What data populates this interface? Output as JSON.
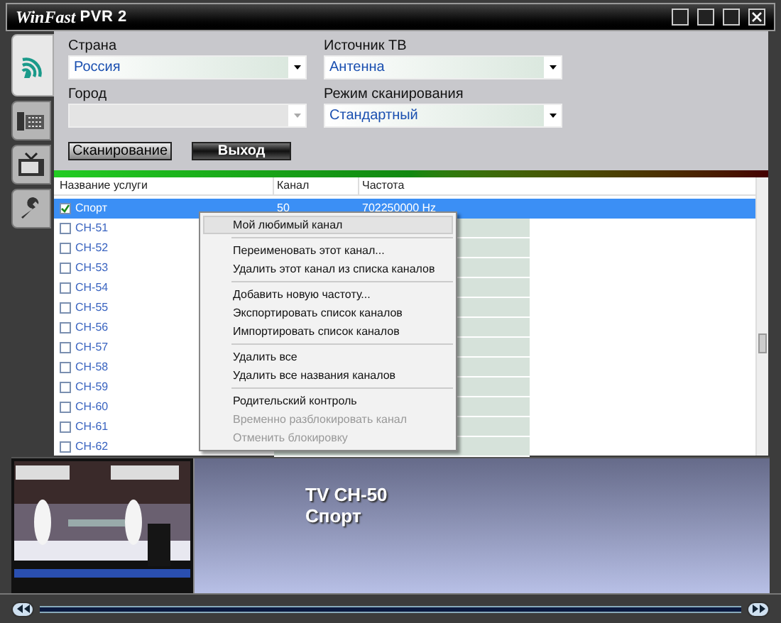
{
  "window": {
    "title": "WinFast",
    "title_badge": "PVR 2"
  },
  "side_tabs": [
    {
      "selected": true
    },
    {
      "selected": false
    },
    {
      "selected": false
    },
    {
      "selected": false
    }
  ],
  "form": {
    "fields": [
      {
        "label": "Страна",
        "value": "Россия",
        "disabled": false
      },
      {
        "label": "Источник ТВ",
        "value": "Антенна",
        "disabled": false
      },
      {
        "label": "Город",
        "disabled": true
      },
      {
        "label": "Режим сканирования",
        "value": "Стандартный",
        "disabled": false
      }
    ],
    "buttons": [
      "Сканирование",
      "Выход"
    ]
  },
  "table": {
    "columns": [
      "Название услуги",
      "Канал",
      "Частота"
    ],
    "rows": [
      {
        "name": "Спорт",
        "checked": true,
        "selected": true,
        "channel": "50",
        "frequency": "702250000 Hz"
      },
      {
        "name": "CH-51",
        "checked": false,
        "selected": false
      },
      {
        "name": "CH-52",
        "checked": false,
        "selected": false
      },
      {
        "name": "CH-53",
        "checked": false,
        "selected": false
      },
      {
        "name": "CH-54",
        "checked": false,
        "selected": false
      },
      {
        "name": "CH-55",
        "checked": false,
        "selected": false
      },
      {
        "name": "CH-56",
        "checked": false,
        "selected": false
      },
      {
        "name": "CH-57",
        "checked": false,
        "selected": false
      },
      {
        "name": "CH-58",
        "checked": false,
        "selected": false
      },
      {
        "name": "CH-59",
        "checked": false,
        "selected": false
      },
      {
        "name": "CH-60",
        "checked": false,
        "selected": false
      },
      {
        "name": "CH-61",
        "checked": false,
        "selected": false
      },
      {
        "name": "CH-62",
        "checked": false,
        "selected": false
      }
    ]
  },
  "context_menu": {
    "groups": [
      {
        "items": [
          {
            "label": "Мой любимый канал",
            "selected": true,
            "disabled": false
          }
        ]
      },
      {
        "items": [
          {
            "label": "Переименовать этот канал...",
            "selected": false,
            "disabled": false
          },
          {
            "label": "Удалить этот канал из списка каналов",
            "selected": false,
            "disabled": false
          }
        ]
      },
      {
        "items": [
          {
            "label": "Добавить новую частоту...",
            "selected": false,
            "disabled": false
          },
          {
            "label": "Экспортировать список каналов",
            "selected": false,
            "disabled": false
          },
          {
            "label": "Импортировать список каналов",
            "selected": false,
            "disabled": false
          }
        ]
      },
      {
        "items": [
          {
            "label": "Удалить все",
            "selected": false,
            "disabled": false
          },
          {
            "label": "Удалить все названия каналов",
            "selected": false,
            "disabled": false
          }
        ]
      },
      {
        "items": [
          {
            "label": "Родительский контроль",
            "selected": false,
            "disabled": false
          },
          {
            "label": "Временно разблокировать канал",
            "selected": false,
            "disabled": true
          },
          {
            "label": "Отменить блокировку",
            "selected": false,
            "disabled": true
          }
        ]
      }
    ]
  },
  "preview": {
    "channel": "TV CH-50",
    "program": "Спорт"
  }
}
